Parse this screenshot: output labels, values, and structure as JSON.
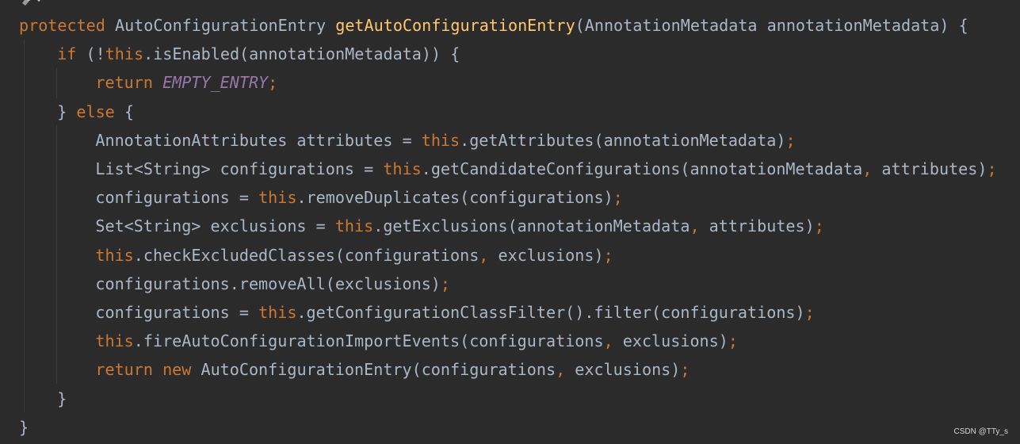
{
  "colors": {
    "background": "#2b2b2b",
    "keyword": "#cc7832",
    "method_declaration": "#ffc66d",
    "identifier": "#a9b7c6",
    "constant": "#9876aa",
    "indent_guide": "#3b3b3b"
  },
  "gutter": {
    "icon": "bean-gutter-icon"
  },
  "code": {
    "lines": [
      {
        "name": "method-signature",
        "tokens": [
          {
            "t": "protected",
            "c": "kw"
          },
          {
            "t": " AutoConfigurationEntry ",
            "c": "id"
          },
          {
            "t": "getAutoConfigurationEntry",
            "c": "fn"
          },
          {
            "t": "(AnnotationMetadata annotationMetadata) {",
            "c": "id"
          }
        ]
      },
      {
        "name": "if-statement",
        "indent": 1,
        "tokens": [
          {
            "t": "if",
            "c": "kw"
          },
          {
            "t": " (!",
            "c": "id"
          },
          {
            "t": "this",
            "c": "kw"
          },
          {
            "t": ".isEnabled(annotationMetadata)) {",
            "c": "id"
          }
        ]
      },
      {
        "name": "return-empty",
        "indent": 2,
        "tokens": [
          {
            "t": "return ",
            "c": "kw"
          },
          {
            "t": "EMPTY_ENTRY",
            "c": "const"
          },
          {
            "t": ";",
            "c": "pun"
          }
        ]
      },
      {
        "name": "else-branch",
        "indent": 1,
        "tokens": [
          {
            "t": "} ",
            "c": "id"
          },
          {
            "t": "else",
            "c": "kw"
          },
          {
            "t": " {",
            "c": "id"
          }
        ]
      },
      {
        "name": "get-attributes",
        "indent": 2,
        "tokens": [
          {
            "t": "AnnotationAttributes attributes = ",
            "c": "id"
          },
          {
            "t": "this",
            "c": "kw"
          },
          {
            "t": ".getAttributes(annotationMetadata)",
            "c": "id"
          },
          {
            "t": ";",
            "c": "pun"
          }
        ]
      },
      {
        "name": "get-candidates",
        "indent": 2,
        "tokens": [
          {
            "t": "List<String> configurations = ",
            "c": "id"
          },
          {
            "t": "this",
            "c": "kw"
          },
          {
            "t": ".getCandidateConfigurations(annotationMetadata",
            "c": "id"
          },
          {
            "t": ", ",
            "c": "pun"
          },
          {
            "t": "attributes)",
            "c": "id"
          },
          {
            "t": ";",
            "c": "pun"
          }
        ]
      },
      {
        "name": "remove-duplicates",
        "indent": 2,
        "tokens": [
          {
            "t": "configurations = ",
            "c": "id"
          },
          {
            "t": "this",
            "c": "kw"
          },
          {
            "t": ".removeDuplicates(configurations)",
            "c": "id"
          },
          {
            "t": ";",
            "c": "pun"
          }
        ]
      },
      {
        "name": "get-exclusions",
        "indent": 2,
        "tokens": [
          {
            "t": "Set<String> exclusions = ",
            "c": "id"
          },
          {
            "t": "this",
            "c": "kw"
          },
          {
            "t": ".getExclusions(annotationMetadata",
            "c": "id"
          },
          {
            "t": ", ",
            "c": "pun"
          },
          {
            "t": "attributes)",
            "c": "id"
          },
          {
            "t": ";",
            "c": "pun"
          }
        ]
      },
      {
        "name": "check-excluded",
        "indent": 2,
        "tokens": [
          {
            "t": "this",
            "c": "kw"
          },
          {
            "t": ".checkExcludedClasses(configurations",
            "c": "id"
          },
          {
            "t": ", ",
            "c": "pun"
          },
          {
            "t": "exclusions)",
            "c": "id"
          },
          {
            "t": ";",
            "c": "pun"
          }
        ]
      },
      {
        "name": "remove-all",
        "indent": 2,
        "tokens": [
          {
            "t": "configurations.removeAll(exclusions)",
            "c": "id"
          },
          {
            "t": ";",
            "c": "pun"
          }
        ]
      },
      {
        "name": "filter",
        "indent": 2,
        "tokens": [
          {
            "t": "configurations = ",
            "c": "id"
          },
          {
            "t": "this",
            "c": "kw"
          },
          {
            "t": ".getConfigurationClassFilter().filter(configurations)",
            "c": "id"
          },
          {
            "t": ";",
            "c": "pun"
          }
        ]
      },
      {
        "name": "fire-events",
        "indent": 2,
        "tokens": [
          {
            "t": "this",
            "c": "kw"
          },
          {
            "t": ".fireAutoConfigurationImportEvents(configurations",
            "c": "id"
          },
          {
            "t": ", ",
            "c": "pun"
          },
          {
            "t": "exclusions)",
            "c": "id"
          },
          {
            "t": ";",
            "c": "pun"
          }
        ]
      },
      {
        "name": "return-entry",
        "indent": 2,
        "tokens": [
          {
            "t": "return new",
            "c": "kw"
          },
          {
            "t": " AutoConfigurationEntry(configurations",
            "c": "id"
          },
          {
            "t": ", ",
            "c": "pun"
          },
          {
            "t": "exclusions)",
            "c": "id"
          },
          {
            "t": ";",
            "c": "pun"
          }
        ]
      },
      {
        "name": "close-else",
        "indent": 1,
        "tokens": [
          {
            "t": "}",
            "c": "id"
          }
        ]
      },
      {
        "name": "close-method",
        "tokens": [
          {
            "t": "}",
            "c": "id"
          }
        ]
      }
    ]
  },
  "watermark": "CSDN @TTy_s"
}
